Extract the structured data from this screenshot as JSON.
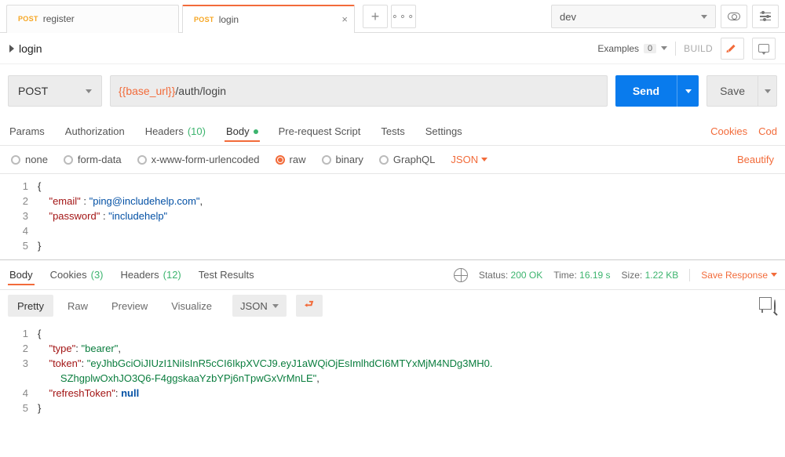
{
  "tabs": [
    {
      "method": "POST",
      "label": "register"
    },
    {
      "method": "POST",
      "label": "login"
    }
  ],
  "env": {
    "name": "dev"
  },
  "request": {
    "name_caret": "▶",
    "name": "login",
    "examples_label": "Examples",
    "examples_count": "0",
    "build": "BUILD",
    "method": "POST",
    "url_var": "{{base_url}}",
    "url_path": "/auth/login",
    "send": "Send",
    "save": "Save"
  },
  "req_tabs": {
    "params": "Params",
    "auth": "Authorization",
    "headers": "Headers",
    "headers_count": "(10)",
    "body": "Body",
    "prereq": "Pre-request Script",
    "tests": "Tests",
    "settings": "Settings",
    "cookies": "Cookies",
    "code": "Cod"
  },
  "body_types": {
    "none": "none",
    "form": "form-data",
    "urlenc": "x-www-form-urlencoded",
    "raw": "raw",
    "binary": "binary",
    "graphql": "GraphQL",
    "json": "JSON",
    "beautify": "Beautify"
  },
  "req_body": {
    "l1": "{",
    "l2_key": "\"email\"",
    "l2_sep": " : ",
    "l2_val": "\"ping@includehelp.com\"",
    "l2_end": ",",
    "l3_key": "\"password\"",
    "l3_sep": " : ",
    "l3_val": "\"includehelp\"",
    "l5": "}"
  },
  "resp_tabs": {
    "body": "Body",
    "cookies": "Cookies",
    "cookies_count": "(3)",
    "headers": "Headers",
    "headers_count": "(12)",
    "tests": "Test Results"
  },
  "resp_meta": {
    "status_label": "Status:",
    "status": "200 OK",
    "time_label": "Time:",
    "time": "16.19 s",
    "size_label": "Size:",
    "size": "1.22 KB",
    "save": "Save Response"
  },
  "resp_view": {
    "pretty": "Pretty",
    "raw": "Raw",
    "preview": "Preview",
    "visualize": "Visualize",
    "json": "JSON"
  },
  "resp_body": {
    "l1": "{",
    "l2_key": "\"type\"",
    "l2_val": "\"bearer\"",
    "l3_key": "\"token\"",
    "l3_val_a": "\"eyJhbGciOiJIUzI1NiIsInR5cCI6IkpXVCJ9.eyJ1aWQiOjEsImlhdCI6MTYxMjM4NDg3MH0.",
    "l3_val_b": "SZhgplwOxhJO3Q6-F4ggskaaYzbYPj6nTpwGxVrMnLE\"",
    "l4_key": "\"refreshToken\"",
    "l4_val": "null",
    "l5": "}"
  },
  "lines": {
    "n1": "1",
    "n2": "2",
    "n3": "3",
    "n4": "4",
    "n5": "5"
  }
}
